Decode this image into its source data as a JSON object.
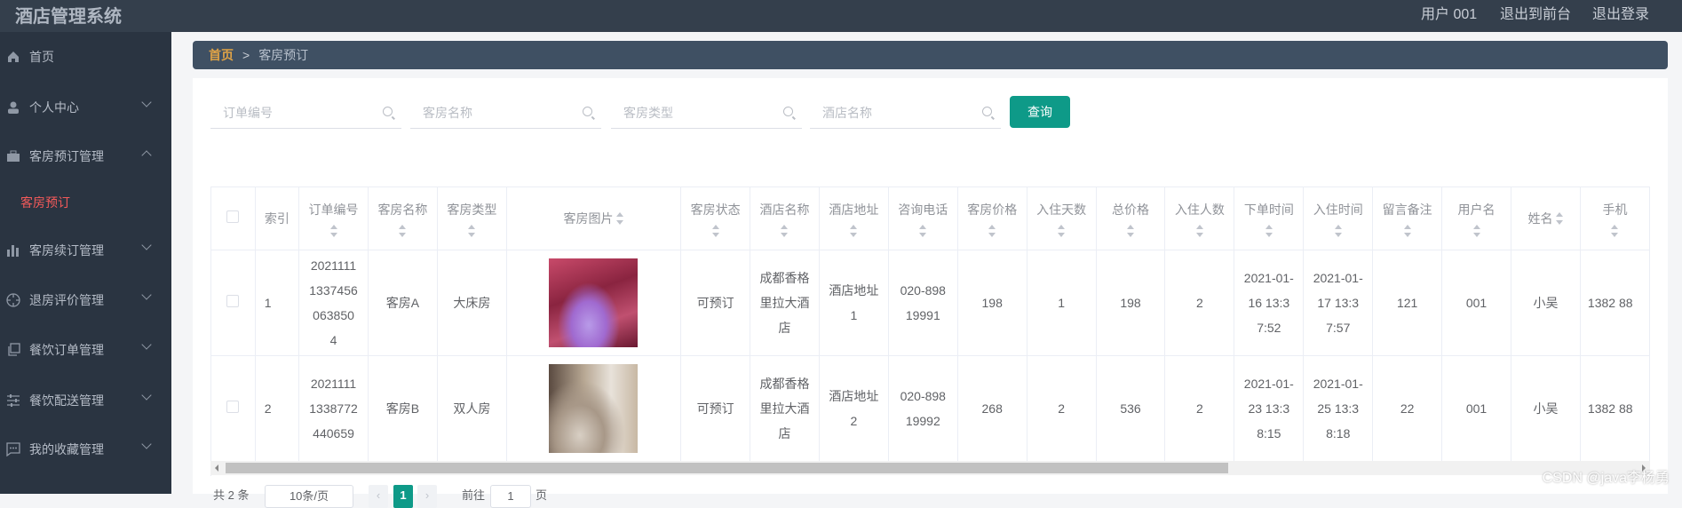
{
  "header": {
    "title": "酒店管理系统",
    "user": "用户 001",
    "to_front": "退出到前台",
    "logout": "退出登录"
  },
  "sidebar": {
    "items": [
      {
        "label": "首页",
        "icon": "home-icon"
      },
      {
        "label": "个人中心",
        "icon": "user-icon"
      },
      {
        "label": "客房预订管理",
        "icon": "briefcase-icon",
        "expanded": true
      },
      {
        "label": "客房续订管理",
        "icon": "bar-chart-icon"
      },
      {
        "label": "退房评价管理",
        "icon": "crosshair-icon"
      },
      {
        "label": "餐饮订单管理",
        "icon": "copy-icon"
      },
      {
        "label": "餐饮配送管理",
        "icon": "sliders-icon"
      },
      {
        "label": "我的收藏管理",
        "icon": "message-icon"
      }
    ],
    "sub_active": "客房预订"
  },
  "breadcrumb": {
    "home": "首页",
    "sep": ">",
    "current": "客房预订"
  },
  "search": {
    "order_no": "订单编号",
    "room_name": "客房名称",
    "room_type": "客房类型",
    "hotel_name": "酒店名称",
    "button": "查询"
  },
  "table": {
    "headers": [
      "索引",
      "订单编号",
      "客房名称",
      "客房类型",
      "客房图片",
      "客房状态",
      "酒店名称",
      "酒店地址",
      "咨询电话",
      "客房价格",
      "入住天数",
      "总价格",
      "入住人数",
      "下单时间",
      "入住时间",
      "留言备注",
      "用户名",
      "姓名",
      "手机"
    ],
    "rows": [
      {
        "index": "1",
        "order_no": "20211111337456063850 4",
        "room_name": "客房A",
        "room_type": "大床房",
        "status": "可预订",
        "hotel": "成都香格里拉大酒店",
        "address": "酒店地址1",
        "phone": "020-89819991",
        "price": "198",
        "days": "1",
        "total": "198",
        "people": "2",
        "order_time": "2021-01-16 13:37:52",
        "checkin_time": "2021-01-17 13:37:57",
        "note": "121",
        "username": "001",
        "name": "小吴",
        "mobile": "1382 88"
      },
      {
        "index": "2",
        "order_no": "20211111338772440659",
        "room_name": "客房B",
        "room_type": "双人房",
        "status": "可预订",
        "hotel": "成都香格里拉大酒店",
        "address": "酒店地址2",
        "phone": "020-89819992",
        "price": "268",
        "days": "2",
        "total": "536",
        "people": "2",
        "order_time": "2021-01-23 13:38:15",
        "checkin_time": "2021-01-25 13:38:18",
        "note": "22",
        "username": "001",
        "name": "小吴",
        "mobile": "1382 88"
      }
    ]
  },
  "pagination": {
    "total": "共 2 条",
    "page_size": "10条/页",
    "page": "1",
    "goto": "前往",
    "goto_value": "1",
    "page_unit": "页"
  },
  "watermark": "CSDN @java李杨勇",
  "colors": {
    "accent": "#0e9a88",
    "active_menu": "#f45a5a",
    "breadcrumb_home": "#e0a346"
  }
}
